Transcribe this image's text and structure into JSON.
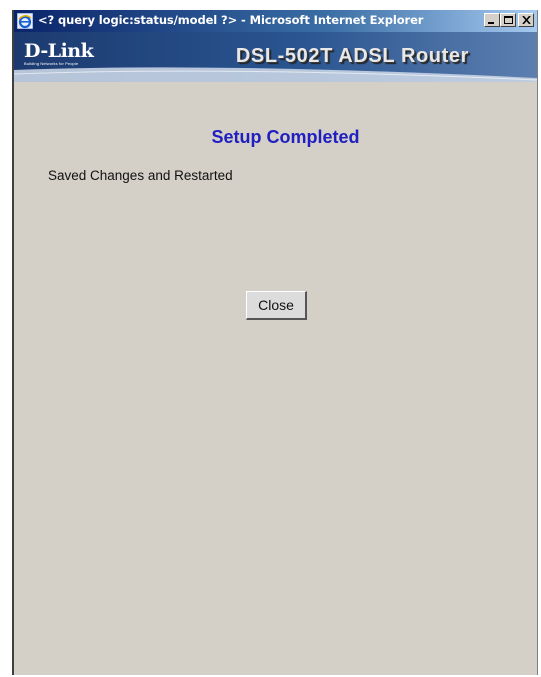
{
  "window": {
    "title": "<? query logic:status/model ?> - Microsoft Internet Explorer"
  },
  "banner": {
    "logo": "D-Link",
    "logo_tagline": "Building Networks for People",
    "product_title": "DSL-502T ADSL Router"
  },
  "page": {
    "heading": "Setup Completed",
    "message": "Saved Changes and Restarted",
    "close_button": "Close"
  },
  "colors": {
    "heading": "#2020c0",
    "background": "#d4d0c8",
    "banner": "#1d3b72"
  }
}
